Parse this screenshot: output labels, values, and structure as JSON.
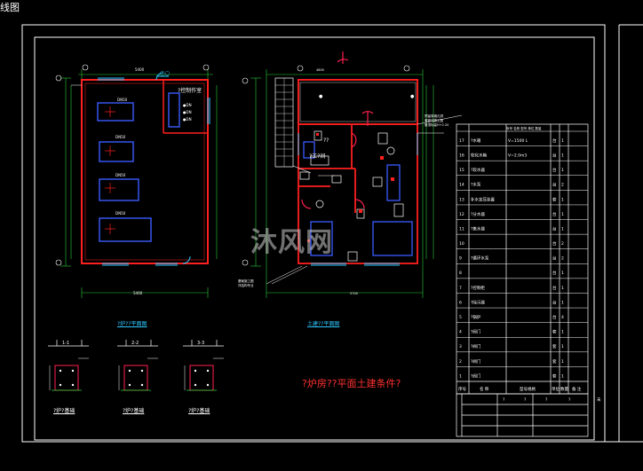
{
  "viewport_tab": "线图",
  "drawing_title": "?炉房??平面土建条件?",
  "watermark": "沐风网",
  "colors": {
    "frame": "#ffffff",
    "wall": "#ff2020",
    "equipment": "#3a5bff",
    "cyan": "#2ec6ff",
    "green": "#27d13b",
    "yellow": "#ffff33",
    "red_title": "#ff3030"
  },
  "plan_captions": {
    "left": "?炉??平面图",
    "middle": "土建??平面图"
  },
  "detail_captions": [
    "?炉?基础",
    "?炉?基础",
    "?炉?基础"
  ],
  "rooms": {
    "control": "?控制作室",
    "toilet": "??",
    "work": "?工?间"
  },
  "table": {
    "rows": [
      {
        "no": "17",
        "name": "?水箱",
        "spec": "V=1500 L",
        "qty": "1",
        "unit": "台"
      },
      {
        "no": "16",
        "name": "软化水箱",
        "spec": "V=2.0m3",
        "qty": "1",
        "unit": "台"
      },
      {
        "no": "15",
        "name": "?软水器",
        "spec": "",
        "qty": "1",
        "unit": "台"
      },
      {
        "no": "14",
        "name": "?水泵",
        "spec": "",
        "qty": "2",
        "unit": "台"
      },
      {
        "no": "13",
        "name": "补水定压装置",
        "spec": "",
        "qty": "1",
        "unit": "套"
      },
      {
        "no": "12",
        "name": "?分水器",
        "spec": "",
        "qty": "1",
        "unit": "台"
      },
      {
        "no": "11",
        "name": "?集水器",
        "spec": "",
        "qty": "1",
        "unit": "台"
      },
      {
        "no": "10",
        "name": "",
        "spec": "",
        "qty": "2",
        "unit": "台"
      },
      {
        "no": "9",
        "name": "?循环水泵",
        "spec": "",
        "qty": "2",
        "unit": "台"
      },
      {
        "no": "8",
        "name": "",
        "spec": "",
        "qty": "1",
        "unit": "台"
      },
      {
        "no": "7",
        "name": "?控制柜",
        "spec": "",
        "qty": "1",
        "unit": "台"
      },
      {
        "no": "6",
        "name": "?除污器",
        "spec": "",
        "qty": "1",
        "unit": "台"
      },
      {
        "no": "5",
        "name": "?锅炉",
        "spec": "",
        "qty": "4",
        "unit": "台"
      },
      {
        "no": "4",
        "name": "?阀门",
        "spec": "",
        "qty": "1",
        "unit": "套"
      },
      {
        "no": "3",
        "name": "?阀门",
        "spec": "",
        "qty": "1",
        "unit": "套"
      },
      {
        "no": "2",
        "name": "?阀门",
        "spec": "",
        "qty": "1",
        "unit": "套"
      },
      {
        "no": "1",
        "name": "?阀门",
        "spec": "",
        "qty": "1",
        "unit": "套"
      }
    ],
    "header": {
      "no": "序号",
      "name": "名 称",
      "spec": "型号规格",
      "unit": "单位",
      "qty": "数量",
      "note": "备 注"
    },
    "footer": {
      "a": "?",
      "b": "?",
      "c": "?",
      "d": "?"
    }
  },
  "side_label": "未"
}
